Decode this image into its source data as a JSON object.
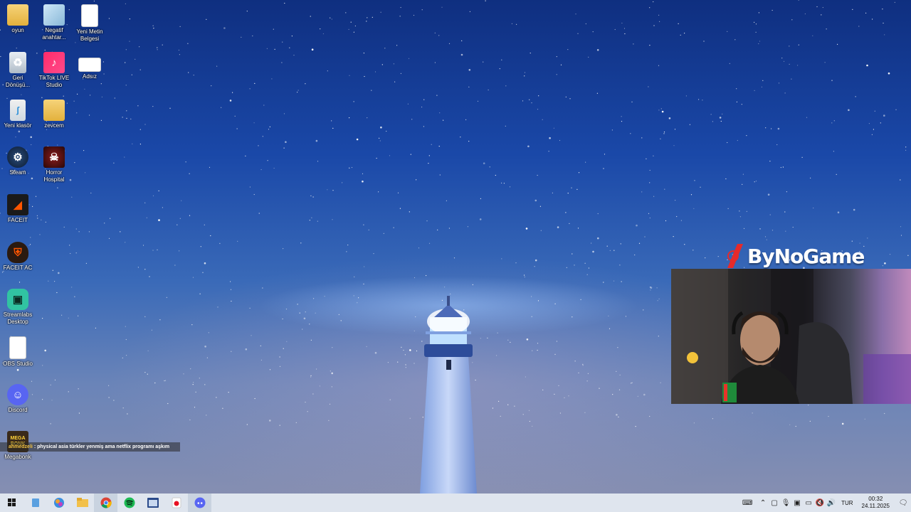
{
  "desktop": {
    "icons": [
      {
        "label": "oyun",
        "icon": "folder-icon"
      },
      {
        "label": "Negatif anahtar...",
        "icon": "document-icon"
      },
      {
        "label": "Yeni Metin Belgesi",
        "icon": "text-file-icon"
      },
      {
        "label": "Geri Dönüşü...",
        "icon": "recycle-bin-icon"
      },
      {
        "label": "TikTok LIVE Studio",
        "icon": "tiktok-icon"
      },
      {
        "label": "Adsız",
        "icon": "image-file-icon"
      },
      {
        "label": "Yeni klasör",
        "icon": "folder-icon"
      },
      {
        "label": "zevcem",
        "icon": "folder-icon"
      },
      {
        "label": "Steam",
        "icon": "steam-icon"
      },
      {
        "label": "Horror Hospital",
        "icon": "game-icon"
      },
      {
        "label": "FACEIT",
        "icon": "faceit-icon"
      },
      {
        "label": "FACEIT AC",
        "icon": "faceit-ac-icon"
      },
      {
        "label": "Streamlabs Desktop",
        "icon": "streamlabs-icon"
      },
      {
        "label": "OBS Studio",
        "icon": "file-icon"
      },
      {
        "label": "Discord",
        "icon": "discord-icon"
      },
      {
        "label": "Megabonk",
        "icon": "megabonk-icon"
      }
    ],
    "megabonk_tile_text": "MEGA BONK"
  },
  "overlay": {
    "brand": "ByNoGame",
    "brand_color": "#e62a2a",
    "chat": {
      "user": "ahmedzeli",
      "message": ": physical asia türkler yenmiş ama netflix programı aşkım"
    }
  },
  "taskbar": {
    "pinned": [
      "start-icon",
      "search-icon",
      "copilot-icon",
      "file-explorer-icon",
      "chrome-icon",
      "spotify-icon",
      "app-window-icon",
      "recorder-icon",
      "discord-icon"
    ],
    "tray": {
      "language": "TUR",
      "time": "00:32",
      "date": "24.11.2025"
    }
  },
  "colors": {
    "taskbar_bg": "#dfe5ee",
    "sky_top": "#0f2f80",
    "sky_bottom": "#8a90b0"
  }
}
